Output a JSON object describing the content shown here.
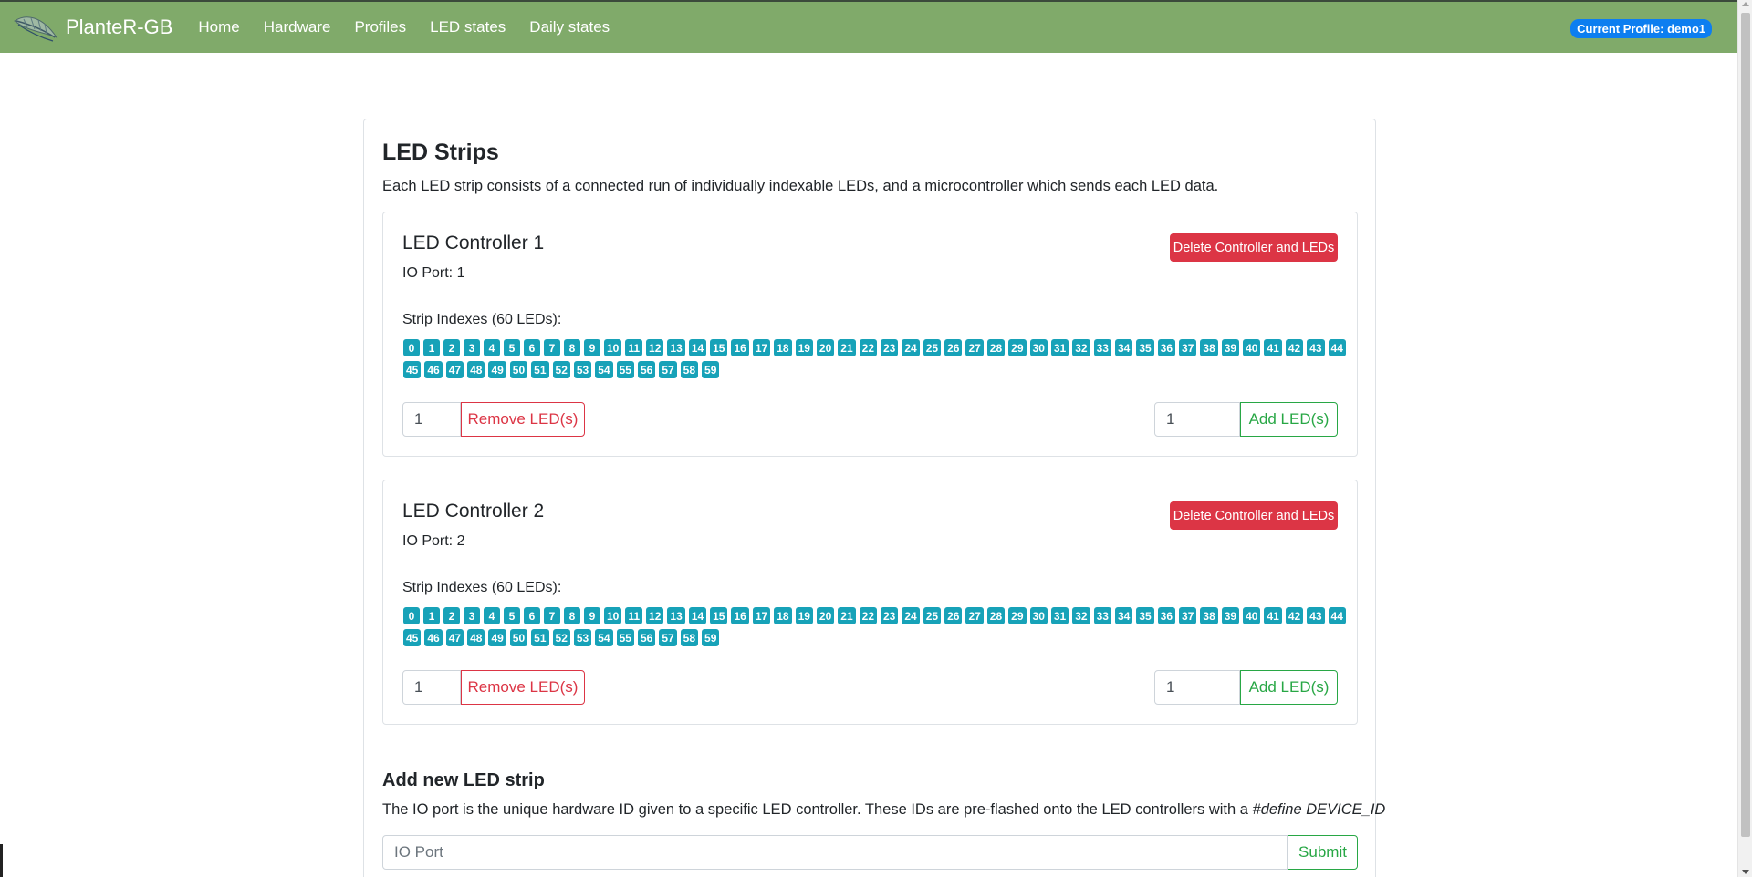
{
  "navbar": {
    "brand": "PlanteR-GB",
    "links": [
      "Home",
      "Hardware",
      "Profiles",
      "LED states",
      "Daily states"
    ],
    "profile_badge": "Current Profile: demo1"
  },
  "main": {
    "title": "LED Strips",
    "description": "Each LED strip consists of a connected run of individually indexable LEDs, and a microcontroller which sends each LED data.",
    "controllers": [
      {
        "title": "LED Controller 1",
        "io_port": "IO Port: 1",
        "delete_label": "Delete Controller and LEDs",
        "strip_label": "Strip Indexes (60 LEDs):",
        "led_count": 60,
        "remove_value": "1",
        "remove_label": "Remove LED(s)",
        "add_value": "1",
        "add_label": "Add LED(s)"
      },
      {
        "title": "LED Controller 2",
        "io_port": "IO Port: 2",
        "delete_label": "Delete Controller and LEDs",
        "strip_label": "Strip Indexes (60 LEDs):",
        "led_count": 60,
        "remove_value": "1",
        "remove_label": "Remove LED(s)",
        "add_value": "1",
        "add_label": "Add LED(s)"
      }
    ],
    "new_strip": {
      "title": "Add new LED strip",
      "description_prefix": "The IO port is the unique hardware ID given to a specific LED controller. These IDs are pre-flashed onto the LED controllers with a ",
      "description_code": "#define DEVICE_ID",
      "placeholder": "IO Port",
      "submit_label": "Submit"
    }
  },
  "colors": {
    "navbar": "#80aa6a",
    "led_badge": "#17a2b8",
    "danger": "#dc3545",
    "success": "#28a745",
    "profile_badge": "#0d7ef0"
  }
}
